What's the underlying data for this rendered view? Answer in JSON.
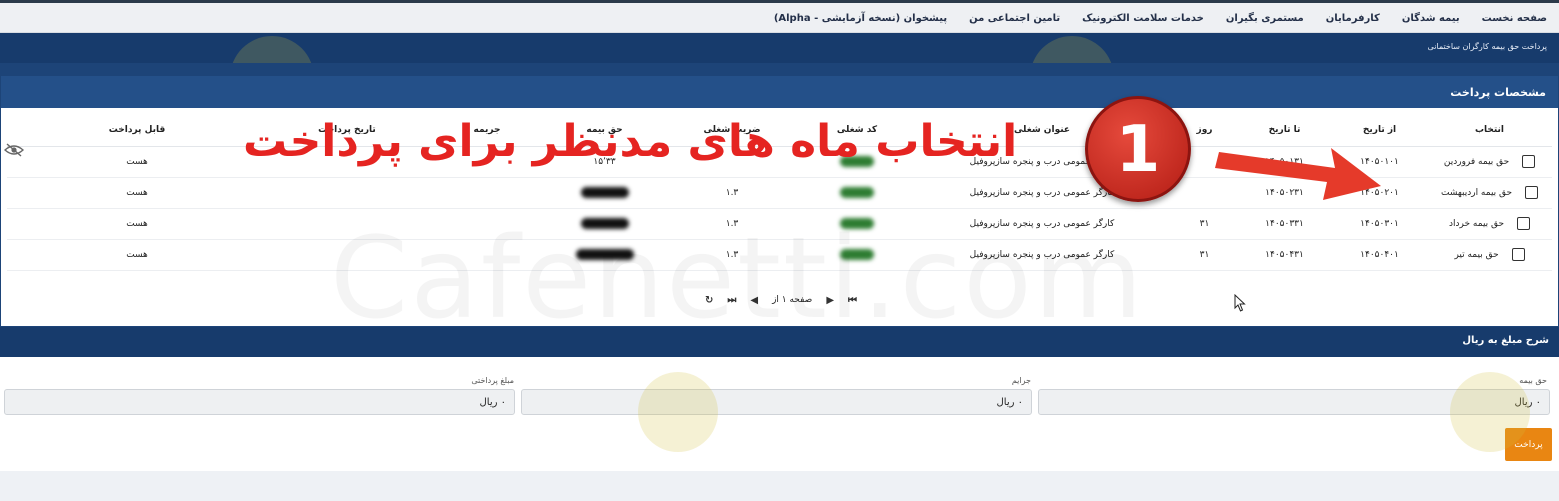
{
  "topnav": {
    "items": [
      "صفحه نخست",
      "بیمه شدگان",
      "کارفرمایان",
      "مستمری بگیران",
      "خدمات سلامت الکترونیک",
      "تامین اجتماعی من",
      "پیشخوان (نسخه آزمایشی - Alpha)"
    ]
  },
  "breadcrumb": "پرداخت حق بیمه کارگران ساختمانی",
  "panel": {
    "title": "مشخصات پرداخت",
    "columns": [
      "انتخاب",
      "از تاریخ",
      "تا تاریخ",
      "روز",
      "عنوان شغلی",
      "کد شغلی",
      "ضریب شغلی",
      "حق بیمه",
      "جریمه",
      "تاریخ پرداخت",
      "قابل پرداخت"
    ],
    "rows": [
      {
        "title": "حق بیمه فروردین",
        "from": "۱۴۰۵۰۱۰۱",
        "to": "۱۴۰۵۰۱۳۱",
        "days": "",
        "job": "کارگر عمومی درب و پنجره سازپروفیل",
        "coef": "",
        "premium": "۱۵٬۳۳",
        "payable": "هست"
      },
      {
        "title": "حق بیمه اردیبهشت",
        "from": "۱۴۰۵۰۲۰۱",
        "to": "۱۴۰۵۰۲۳۱",
        "days": "",
        "job": "کارگر عمومی درب و پنجره سازپروفیل",
        "coef": "۱.۳",
        "premium": "",
        "payable": "هست"
      },
      {
        "title": "حق بیمه خرداد",
        "from": "۱۴۰۵۰۳۰۱",
        "to": "۱۴۰۵۰۳۳۱",
        "days": "۳۱",
        "job": "کارگر عمومی درب و پنجره سازپروفیل",
        "coef": "۱.۳",
        "premium": "",
        "payable": "هست"
      },
      {
        "title": "حق بیمه تیر",
        "from": "۱۴۰۵۰۴۰۱",
        "to": "۱۴۰۵۰۴۳۱",
        "days": "۳۱",
        "job": "کارگر عمومی درب و پنجره سازپروفیل",
        "coef": "۱.۳",
        "premium": "",
        "payable": "هست"
      }
    ],
    "pager": {
      "page_label": "صفحه ۱ از"
    }
  },
  "explanation": {
    "title": "شرح مبلغ به ریال",
    "premium_label": "حق بیمه",
    "premium_value": "۰ ریال",
    "fines_label": "جرایم",
    "fines_value": "۰ ریال",
    "payment_label": "مبلغ پرداختی",
    "payment_value": "۰ ریال",
    "pay_button": "پرداخت"
  },
  "overlay": {
    "text": "انتخاب ماه های مدنظر برای پرداخت",
    "badge": "1",
    "watermark": "Cafenetti.com"
  },
  "colors": {
    "nav_bg": "#eef0f3",
    "bar_blue": "#173b6c",
    "header_blue": "#245089",
    "pay_orange": "#e98612",
    "overlay_red": "#e52421"
  }
}
